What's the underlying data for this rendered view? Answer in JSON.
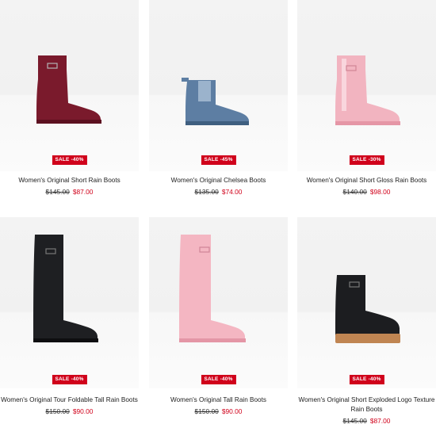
{
  "colors": {
    "sale_badge": "#d0021b",
    "sale_price": "#d0021b",
    "text": "#222222"
  },
  "products": [
    {
      "name": "Women's Original Short Rain Boots",
      "badge": "SALE -40%",
      "old_price": "$145.00",
      "new_price": "$87.00",
      "boot_color": "#7a1a2c"
    },
    {
      "name": "Women's Original Chelsea Boots",
      "badge": "SALE -45%",
      "old_price": "$135.00",
      "new_price": "$74.00",
      "boot_color": "#5d7ea3"
    },
    {
      "name": "Women's Original Short Gloss Rain Boots",
      "badge": "SALE -30%",
      "old_price": "$140.00",
      "new_price": "$98.00",
      "boot_color": "#f2b4c0"
    },
    {
      "name": "Women's Original Tour Foldable Tall Rain Boots",
      "badge": "SALE -40%",
      "old_price": "$150.00",
      "new_price": "$90.00",
      "boot_color": "#1e1f22"
    },
    {
      "name": "Women's Original Tall Rain Boots",
      "badge": "SALE -40%",
      "old_price": "$150.00",
      "new_price": "$90.00",
      "boot_color": "#f4b6c2"
    },
    {
      "name": "Women's Original Short Exploded Logo Texture",
      "name_line2": "Rain Boots",
      "badge": "SALE -40%",
      "old_price": "$145.00",
      "new_price": "$87.00",
      "boot_color": "#1c1d20"
    }
  ]
}
